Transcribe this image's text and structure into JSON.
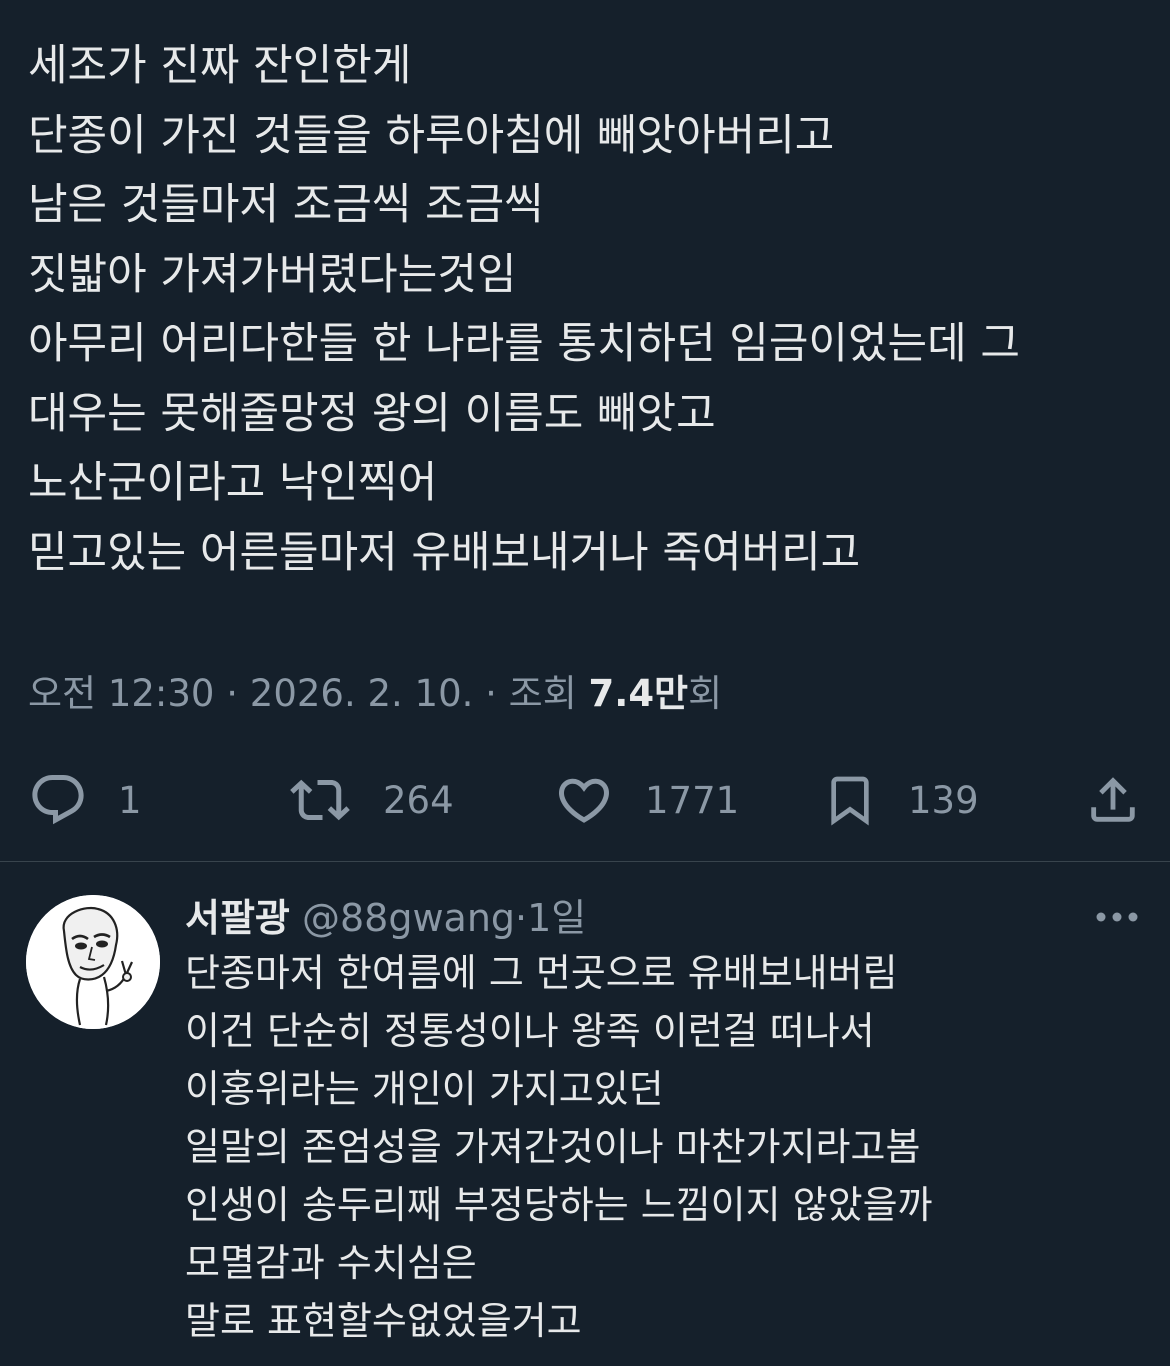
{
  "tweet": {
    "lines": [
      "세조가 진짜 잔인한게",
      "단종이 가진 것들을 하루아침에 빼앗아버리고",
      "남은 것들마저 조금씩 조금씩",
      "짓밟아 가져가버렸다는것임",
      "아무리 어리다한들 한 나라를 통치하던 임금이었는데 그",
      "대우는 못해줄망정 왕의 이름도 빼앗고",
      "노산군이라고 낙인찍어",
      "믿고있는 어른들마저 유배보내거나 죽여버리고"
    ],
    "meta": {
      "time": "오전 12:30",
      "separator": " · ",
      "date": "2026. 2. 10.",
      "views_label": "조회 ",
      "views_value": "7.4만",
      "views_suffix": "회"
    },
    "actions": {
      "reply_count": "1",
      "retweet_count": "264",
      "like_count": "1771",
      "bookmark_count": "139"
    }
  },
  "reply": {
    "name": "서팔광",
    "handle": "@88gwang",
    "separator": "·",
    "time": "1일",
    "lines": [
      "단종마저 한여름에 그 먼곳으로 유배보내버림",
      "이건 단순히 정통성이나 왕족 이런걸 떠나서",
      "이홍위라는 개인이 가지고있던",
      "일말의 존엄성을 가져간것이나 마찬가지라고봄",
      "인생이 송두리째 부정당하는 느낌이지 않았을까",
      "모멸감과 수치심은",
      "말로 표현할수없었을거고"
    ]
  },
  "colors": {
    "background": "#15202b",
    "text_primary": "#e7e9ea",
    "text_secondary": "#8b98a5",
    "divider": "#38444d"
  },
  "icons": {
    "reply": "speech-bubble-icon",
    "retweet": "retweet-icon",
    "like": "heart-icon",
    "bookmark": "bookmark-icon",
    "share": "share-icon",
    "more": "more-dots-icon"
  }
}
